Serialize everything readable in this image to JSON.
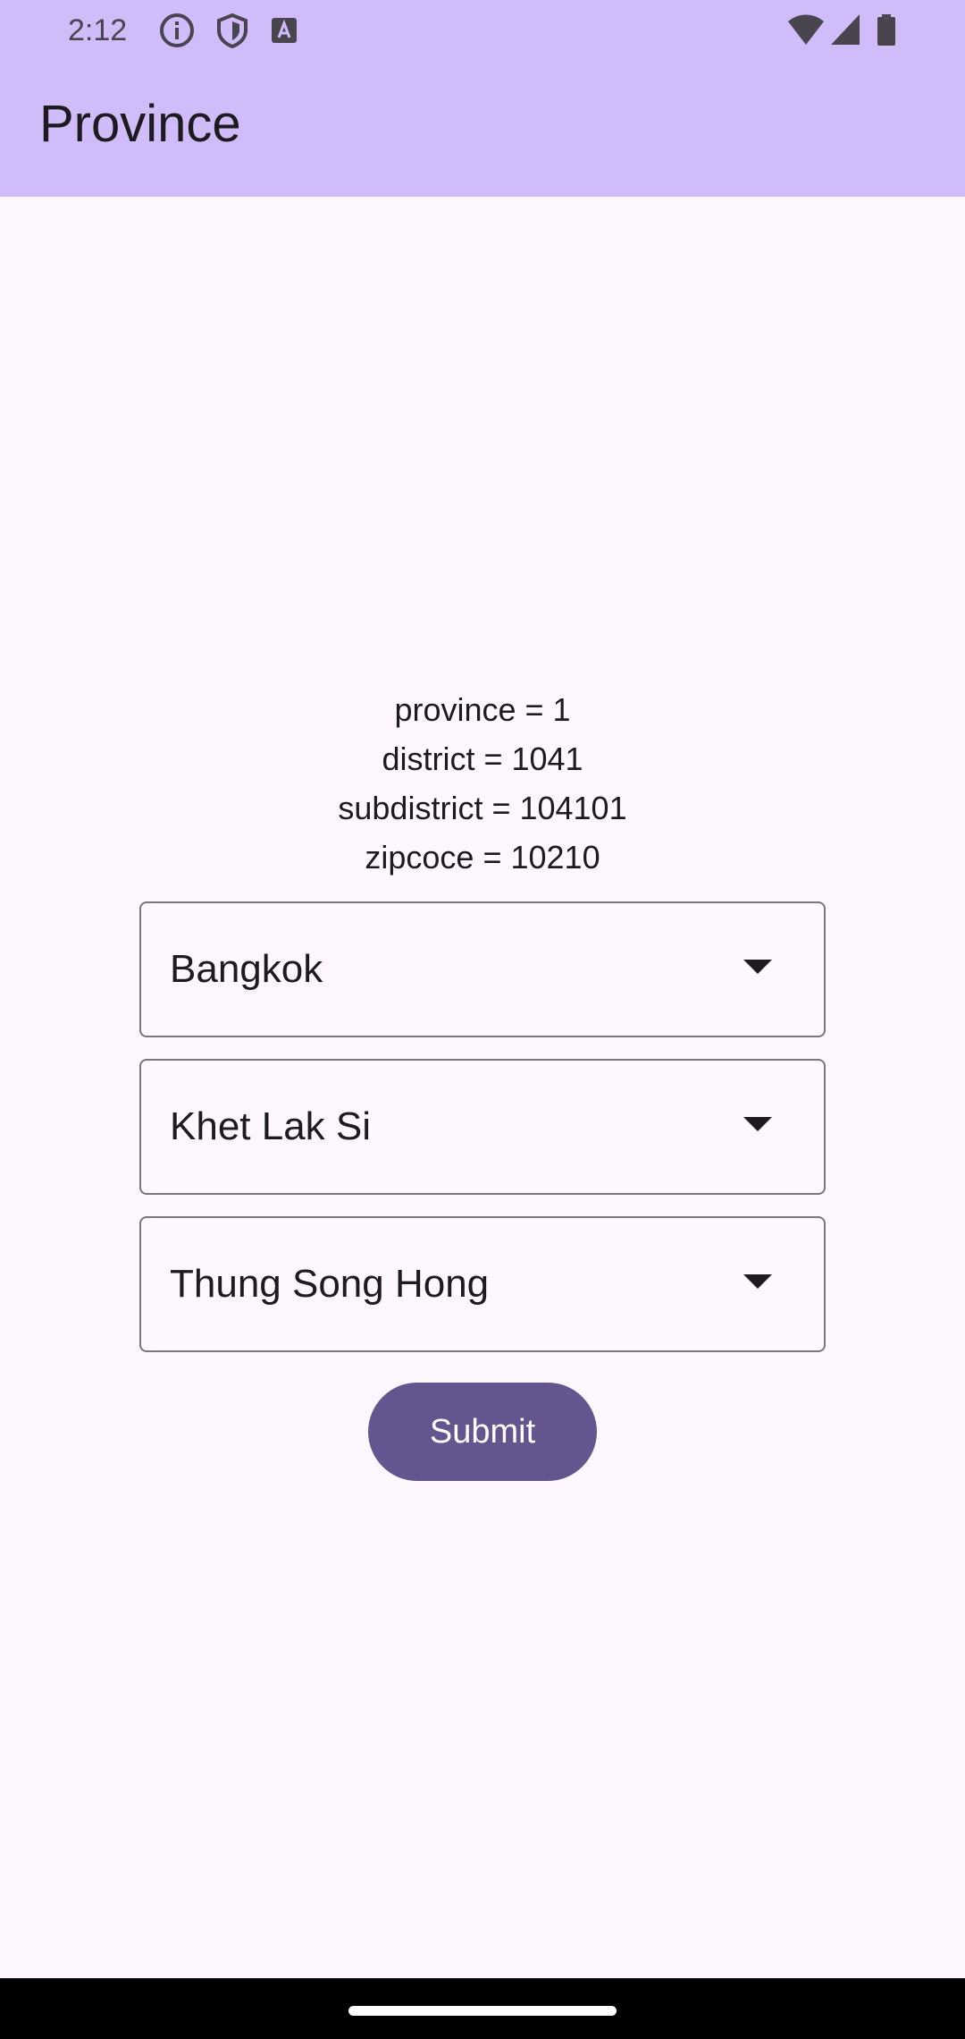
{
  "status_bar": {
    "time": "2:12",
    "left_icons": [
      "info-icon",
      "shield-icon",
      "text-a-icon"
    ],
    "right_icons": [
      "wifi-icon",
      "cellular-signal-icon",
      "battery-icon"
    ]
  },
  "app_bar": {
    "title": "Province"
  },
  "info": {
    "province_line": "province = 1",
    "district_line": "district = 1041",
    "subdistrict_line": "subdistrict = 104101",
    "zipcode_line": "zipcoce = 10210"
  },
  "dropdowns": {
    "province": {
      "value": "Bangkok"
    },
    "district": {
      "value": "Khet Lak Si"
    },
    "subdistrict": {
      "value": "Thung Song Hong"
    }
  },
  "submit": {
    "label": "Submit"
  },
  "colors": {
    "app_bar": "#D1BCFA",
    "background": "#FEF7FF",
    "button": "#65558F",
    "outline": "#79747E"
  }
}
